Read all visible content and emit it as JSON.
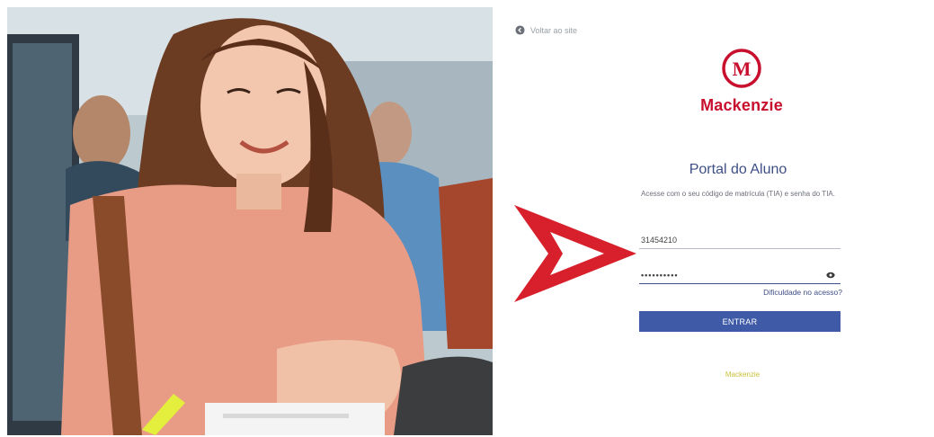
{
  "back_link": {
    "label": "Voltar ao site"
  },
  "logo": {
    "letter": "M",
    "name": "Mackenzie"
  },
  "portal": {
    "title": "Portal do Aluno",
    "subtitle": "Acesse com o seu código de matrícula (TIA) e senha do TIA."
  },
  "form": {
    "tia_value": "31454210",
    "password_mask": "••••••••••",
    "forgot_label": "Dificuldade no acesso?",
    "submit_label": "ENTRAR"
  },
  "footer": {
    "mark": "Mackenzie"
  },
  "colors": {
    "brand_red": "#c8102e",
    "accent_blue": "#3f5ba8",
    "title_blue": "#3e4f87",
    "arrow_red": "#d7202c"
  }
}
